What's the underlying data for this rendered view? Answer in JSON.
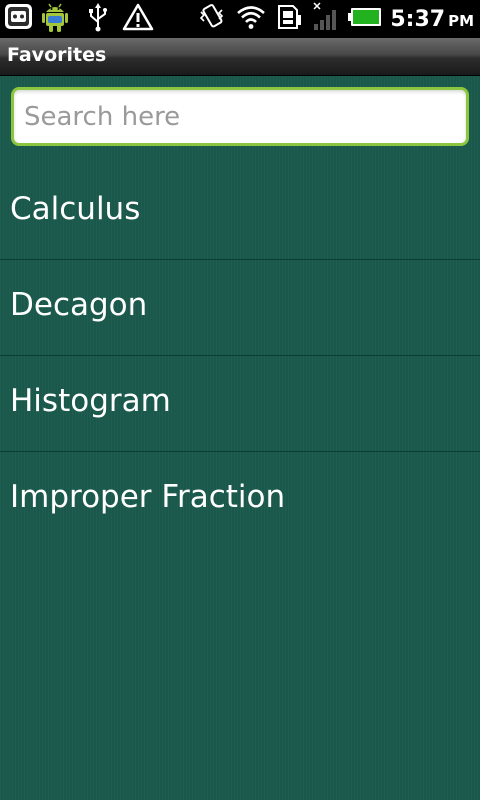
{
  "status_bar": {
    "time": "5:37",
    "ampm": "PM",
    "icons": [
      "bbm-icon",
      "android-icon",
      "usb-icon",
      "warning-icon",
      "vibrate-icon",
      "wifi-icon",
      "sim-card-icon",
      "no-signal-icon",
      "battery-icon"
    ],
    "battery_color": "#22b21f"
  },
  "title_bar": {
    "title": "Favorites"
  },
  "search": {
    "placeholder": "Search here",
    "value": "",
    "border_color": "#8bc63f"
  },
  "list": {
    "items": [
      {
        "label": "Calculus"
      },
      {
        "label": "Decagon"
      },
      {
        "label": "Histogram"
      },
      {
        "label": "Improper Fraction"
      }
    ]
  },
  "colors": {
    "background": "#1b5a4c",
    "divider": "#0f3b31"
  }
}
